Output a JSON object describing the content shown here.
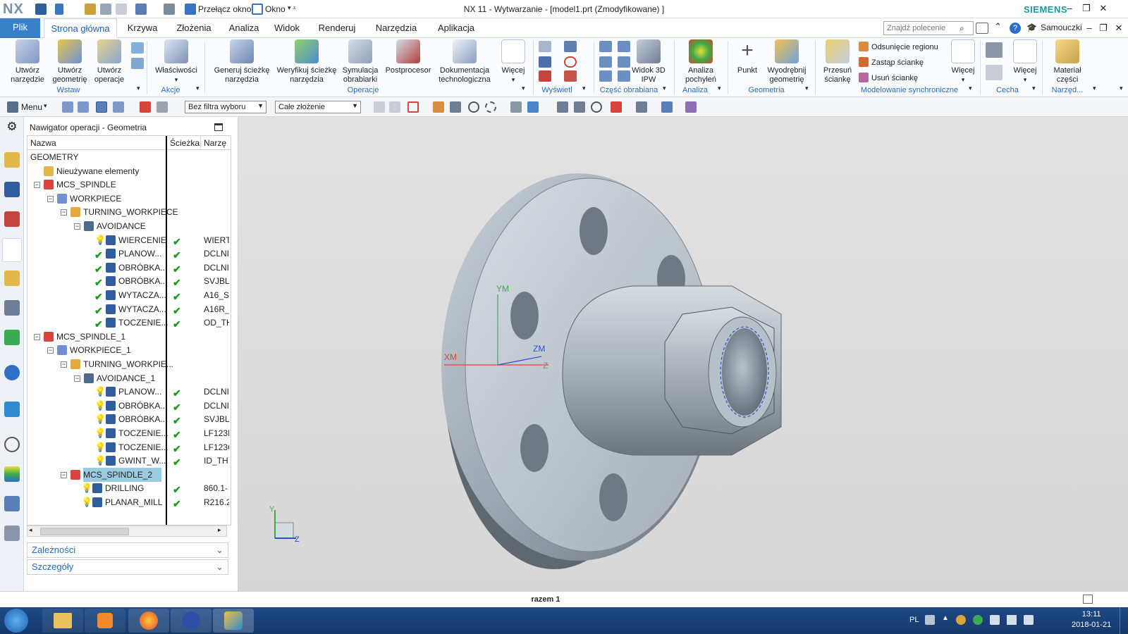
{
  "app": {
    "logo": "NX",
    "title": "NX 11 - Wytwarzanie - [model1.prt (Zmodyfikowane) ]",
    "brand": "SIEMENS",
    "switch_window": "Przełącz okno",
    "window_menu": "Okno"
  },
  "menu": {
    "file": "Plik",
    "tabs": [
      "Strona główna",
      "Krzywa",
      "Złożenia",
      "Analiza",
      "Widok",
      "Renderuj",
      "Narzędzia",
      "Aplikacja"
    ],
    "search_placeholder": "Znajdź polecenie",
    "help": "Samouczki"
  },
  "ribbon": {
    "buttons": {
      "create_tool": "Utwórz narzędzie",
      "create_geometry": "Utwórz geometrię",
      "create_operation": "Utwórz operacje",
      "properties": "Właściwości",
      "generate_path": "Generuj ścieżkę narzędzia",
      "verify_path": "Weryfikuj ścieżkę narzędzia",
      "simulation": "Symulacja obrabiarki",
      "postprocessor": "Postprocesor",
      "documentation": "Dokumentacja technologiczna",
      "more1": "Więcej",
      "ipw": "Widok 3D IPW",
      "draft_analysis": "Analiza pochyleń",
      "point": "Punkt",
      "extract_geometry": "Wyodrębnij geometrię",
      "move_face": "Przesuń ściankę",
      "more2": "Więcej",
      "more3": "Więcej",
      "part_material": "Materiał części"
    },
    "sync_items": [
      "Odsunięcie regionu",
      "Zastąp ściankę",
      "Usuń ściankę"
    ],
    "groups": [
      "Wstaw",
      "Akcje",
      "Operacje",
      "Wyświetl",
      "Część obrabiana",
      "Analiza",
      "Geometria",
      "Modelowanie synchroniczne",
      "Cecha",
      "Narzęd..."
    ]
  },
  "toolbar": {
    "menu": "Menu",
    "filter": "Bez filtra wyboru",
    "scope": "Całe złożenie"
  },
  "navigator": {
    "title": "Nawigator operacji - Geometria",
    "columns": [
      "Nazwa",
      "Ścieżka",
      "Narzę"
    ],
    "rows": [
      {
        "name": "GEOMETRY",
        "tool": ""
      },
      {
        "name": "Nieużywane elementy",
        "tool": ""
      },
      {
        "name": "MCS_SPINDLE",
        "tool": ""
      },
      {
        "name": "WORKPIECE",
        "tool": ""
      },
      {
        "name": "TURNING_WORKPIECE",
        "tool": ""
      },
      {
        "name": "AVOIDANCE",
        "tool": ""
      },
      {
        "name": "WIERCENIE",
        "tool": "WIERT"
      },
      {
        "name": "PLANOW...",
        "tool": "DCLNI"
      },
      {
        "name": "OBRÓBKA...",
        "tool": "DCLNI"
      },
      {
        "name": "OBRÓBKA...",
        "tool": "SVJBL_"
      },
      {
        "name": "WYTACZA...",
        "tool": "A16_S"
      },
      {
        "name": "WYTACZA...",
        "tool": "A16R_"
      },
      {
        "name": "TOCZENIE...",
        "tool": "OD_TH"
      },
      {
        "name": "MCS_SPINDLE_1",
        "tool": ""
      },
      {
        "name": "WORKPIECE_1",
        "tool": ""
      },
      {
        "name": "TURNING_WORKPIE...",
        "tool": ""
      },
      {
        "name": "AVOIDANCE_1",
        "tool": ""
      },
      {
        "name": "PLANOW...",
        "tool": "DCLNI"
      },
      {
        "name": "OBRÓBKA...",
        "tool": "DCLNI"
      },
      {
        "name": "OBRÓBKA...",
        "tool": "SVJBL_"
      },
      {
        "name": "TOCZENIE...",
        "tool": "LF123I"
      },
      {
        "name": "TOCZENIE...",
        "tool": "LF123C"
      },
      {
        "name": "GWINT_W...",
        "tool": "ID_TH"
      },
      {
        "name": "MCS_SPINDLE_2",
        "tool": ""
      },
      {
        "name": "DRILLING",
        "tool": "860.1-"
      },
      {
        "name": "PLANAR_MILL",
        "tool": "R216.2"
      }
    ],
    "panels": [
      "Zależności",
      "Szczegóły"
    ]
  },
  "viewport": {
    "axes": [
      "YM",
      "XM",
      "ZM",
      "Z"
    ],
    "triad": [
      "Y",
      "Z"
    ]
  },
  "status": {
    "text": "razem 1"
  },
  "taskbar": {
    "lang": "PL",
    "time": "13:11",
    "date": "2018-01-21"
  }
}
